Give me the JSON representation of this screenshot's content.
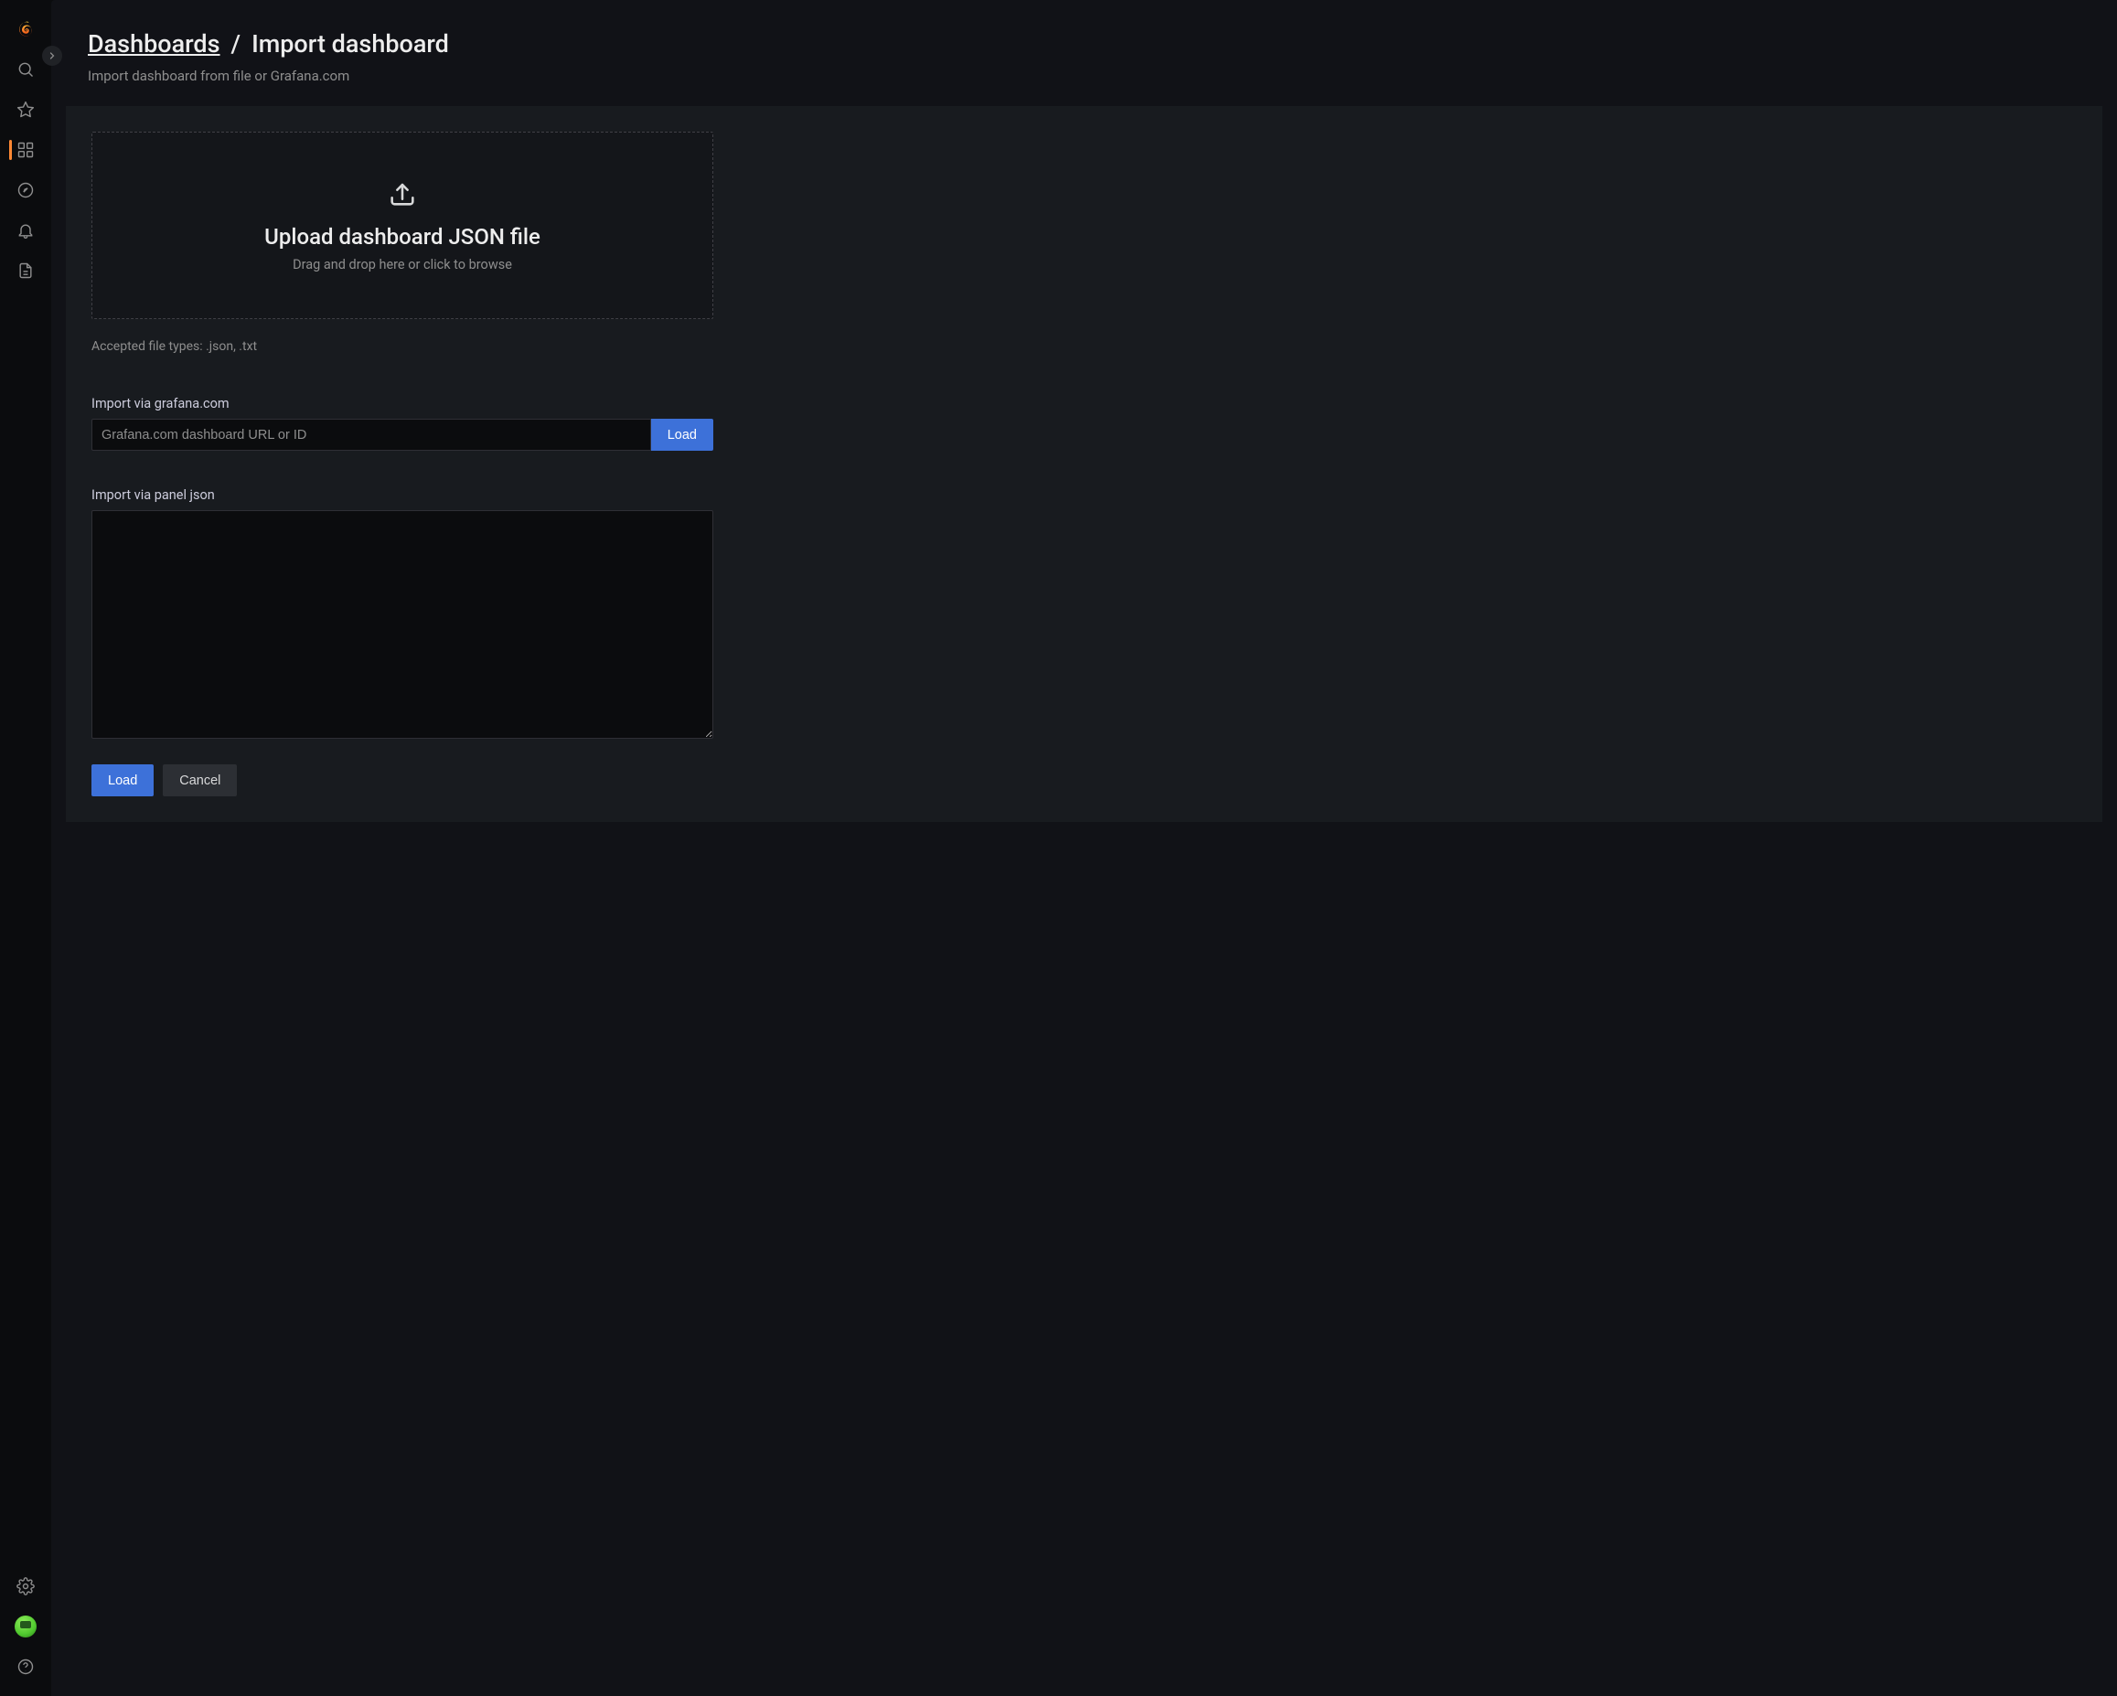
{
  "sidebar": {
    "items": [
      {
        "name": "grafana-logo"
      },
      {
        "name": "search-icon"
      },
      {
        "name": "star-icon"
      },
      {
        "name": "dashboards-icon",
        "active": true
      },
      {
        "name": "explore-icon"
      },
      {
        "name": "alert-icon"
      },
      {
        "name": "connections-icon"
      }
    ],
    "bottom_items": [
      {
        "name": "settings-icon"
      },
      {
        "name": "user-avatar"
      },
      {
        "name": "help-icon"
      }
    ]
  },
  "header": {
    "breadcrumb_link": "Dashboards",
    "breadcrumb_sep": "/",
    "breadcrumb_current": "Import dashboard",
    "subtitle": "Import dashboard from file or Grafana.com"
  },
  "upload": {
    "title": "Upload dashboard JSON file",
    "hint": "Drag and drop here or click to browse",
    "accepted": "Accepted file types: .json, .txt"
  },
  "import_url": {
    "label": "Import via grafana.com",
    "placeholder": "Grafana.com dashboard URL or ID",
    "button": "Load"
  },
  "import_json": {
    "label": "Import via panel json"
  },
  "buttons": {
    "load": "Load",
    "cancel": "Cancel"
  }
}
